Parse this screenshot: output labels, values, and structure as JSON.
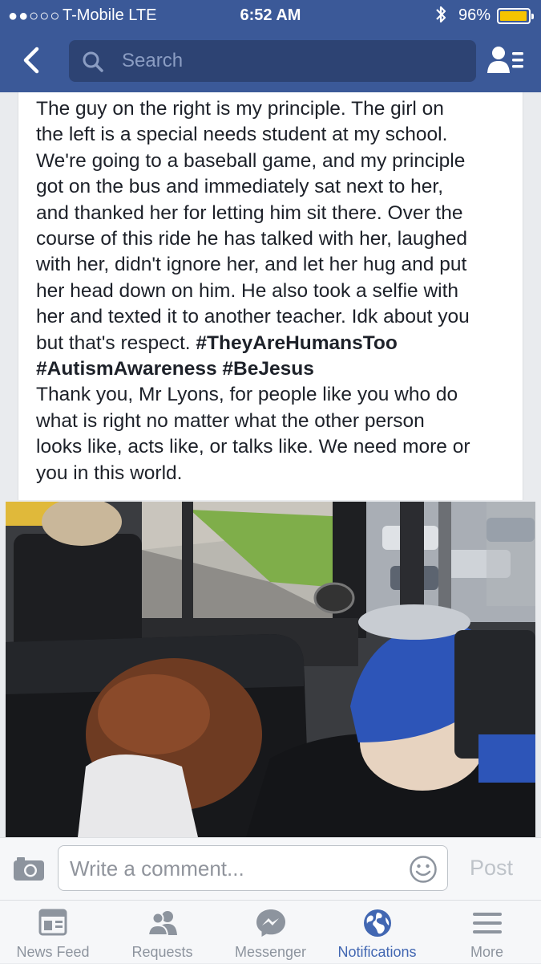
{
  "status_bar": {
    "signal": "●●○○○",
    "carrier": "T-Mobile  LTE",
    "time": "6:52 AM",
    "battery": "96%",
    "battery_level": 0.96
  },
  "nav": {
    "search_placeholder": "Search"
  },
  "post": {
    "text_lines": [
      "The guy on the right is my principle. The girl on",
      "the left is a special needs student at my school.",
      "We're going to a baseball game, and my principle",
      "got on the bus and immediately sat next to her,",
      "and thanked her for letting him sit there. Over the",
      "course of this ride he has talked with her, laughed",
      "with her, didn't ignore her, and let her hug and put",
      "her head down on him. He also took a selfie with",
      "her and texted it to another teacher. Idk about you"
    ],
    "line10_plain": "but that's respect. ",
    "hashtag1": "#TheyAreHumansToo",
    "hashtag2": "#AutismAwareness",
    "hashtag3": "#BeJesus",
    "thanks_lines": [
      "Thank you, Mr Lyons, for people like you who do",
      "what is right no matter what the other person",
      "looks like, acts like, or talks like. We need more or",
      "you in this world."
    ]
  },
  "comment": {
    "placeholder": "Write a comment...",
    "post_label": "Post"
  },
  "tabs": [
    {
      "label": "News Feed",
      "icon": "news-feed-icon"
    },
    {
      "label": "Requests",
      "icon": "friend-requests-icon"
    },
    {
      "label": "Messenger",
      "icon": "messenger-icon"
    },
    {
      "label": "Notifications",
      "icon": "globe-icon",
      "active": true
    },
    {
      "label": "More",
      "icon": "menu-icon"
    }
  ],
  "colors": {
    "brand": "#3b5998",
    "active_tab": "#4267b2",
    "battery": "#f5c400"
  }
}
